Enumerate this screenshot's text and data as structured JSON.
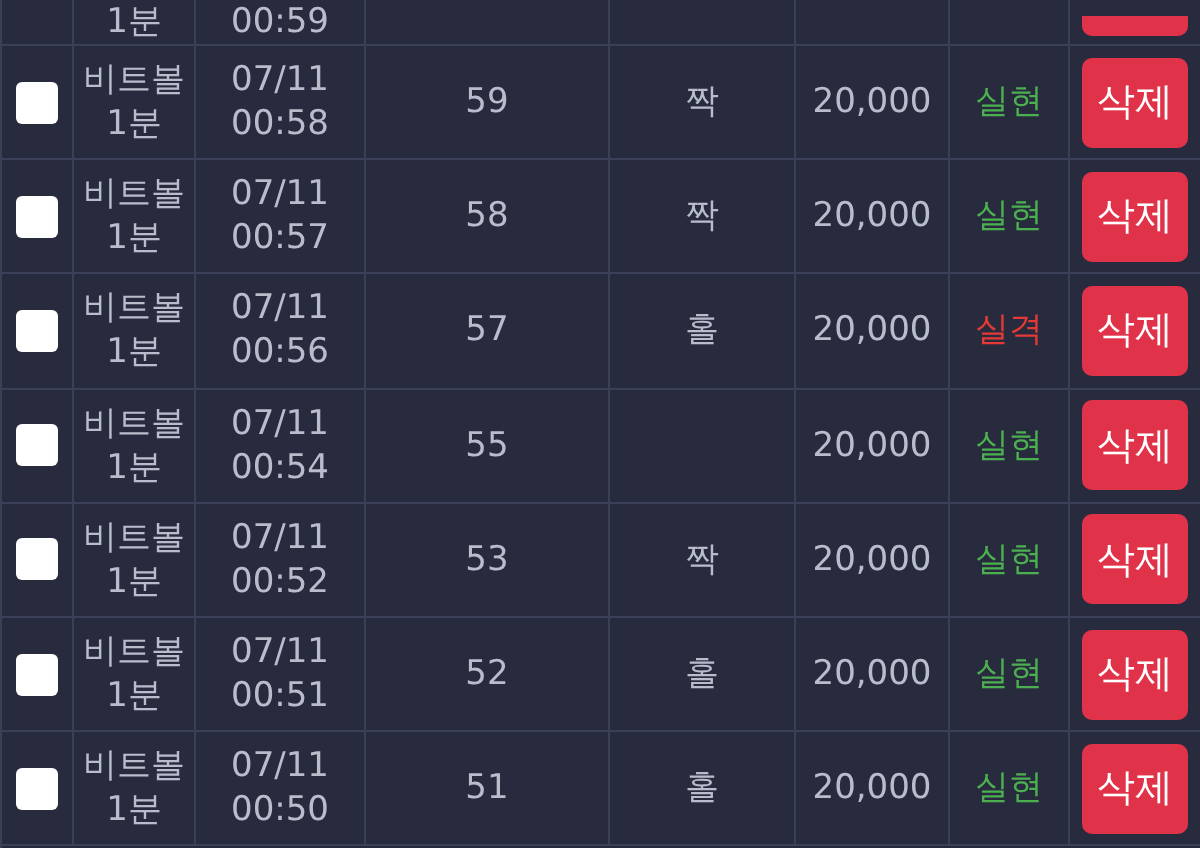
{
  "partial_row": {
    "game": "1분",
    "time": "00:59"
  },
  "rows": [
    {
      "checked": false,
      "game": [
        "비트볼",
        "1분"
      ],
      "time": [
        "07/11",
        "00:58"
      ],
      "round": "59",
      "pick": "짝",
      "amount": "20,000",
      "result": {
        "text": "실현",
        "kind": "win"
      },
      "delete": "삭제"
    },
    {
      "checked": false,
      "game": [
        "비트볼",
        "1분"
      ],
      "time": [
        "07/11",
        "00:57"
      ],
      "round": "58",
      "pick": "짝",
      "amount": "20,000",
      "result": {
        "text": "실현",
        "kind": "win"
      },
      "delete": "삭제"
    },
    {
      "checked": false,
      "game": [
        "비트볼",
        "1분"
      ],
      "time": [
        "07/11",
        "00:56"
      ],
      "round": "57",
      "pick": "홀",
      "amount": "20,000",
      "result": {
        "text": "실격",
        "kind": "loss"
      },
      "delete": "삭제"
    },
    {
      "checked": false,
      "game": [
        "비트볼",
        "1분"
      ],
      "time": [
        "07/11",
        "00:54"
      ],
      "round": "55",
      "amount": "20,000",
      "result": {
        "text": "실현",
        "kind": "win"
      },
      "delete": "삭제"
    },
    {
      "checked": false,
      "game": [
        "비트볼",
        "1분"
      ],
      "time": [
        "07/11",
        "00:52"
      ],
      "round": "53",
      "pick": "짝",
      "amount": "20,000",
      "result": {
        "text": "실현",
        "kind": "win"
      },
      "delete": "삭제"
    },
    {
      "checked": false,
      "game": [
        "비트볼",
        "1분"
      ],
      "time": [
        "07/11",
        "00:51"
      ],
      "round": "52",
      "pick": "홀",
      "amount": "20,000",
      "result": {
        "text": "실현",
        "kind": "win"
      },
      "delete": "삭제"
    },
    {
      "checked": false,
      "game": [
        "비트볼",
        "1분"
      ],
      "time": [
        "07/11",
        "00:50"
      ],
      "round": "51",
      "pick": "홀",
      "amount": "20,000",
      "result": {
        "text": "실현",
        "kind": "win"
      },
      "delete": "삭제"
    }
  ]
}
